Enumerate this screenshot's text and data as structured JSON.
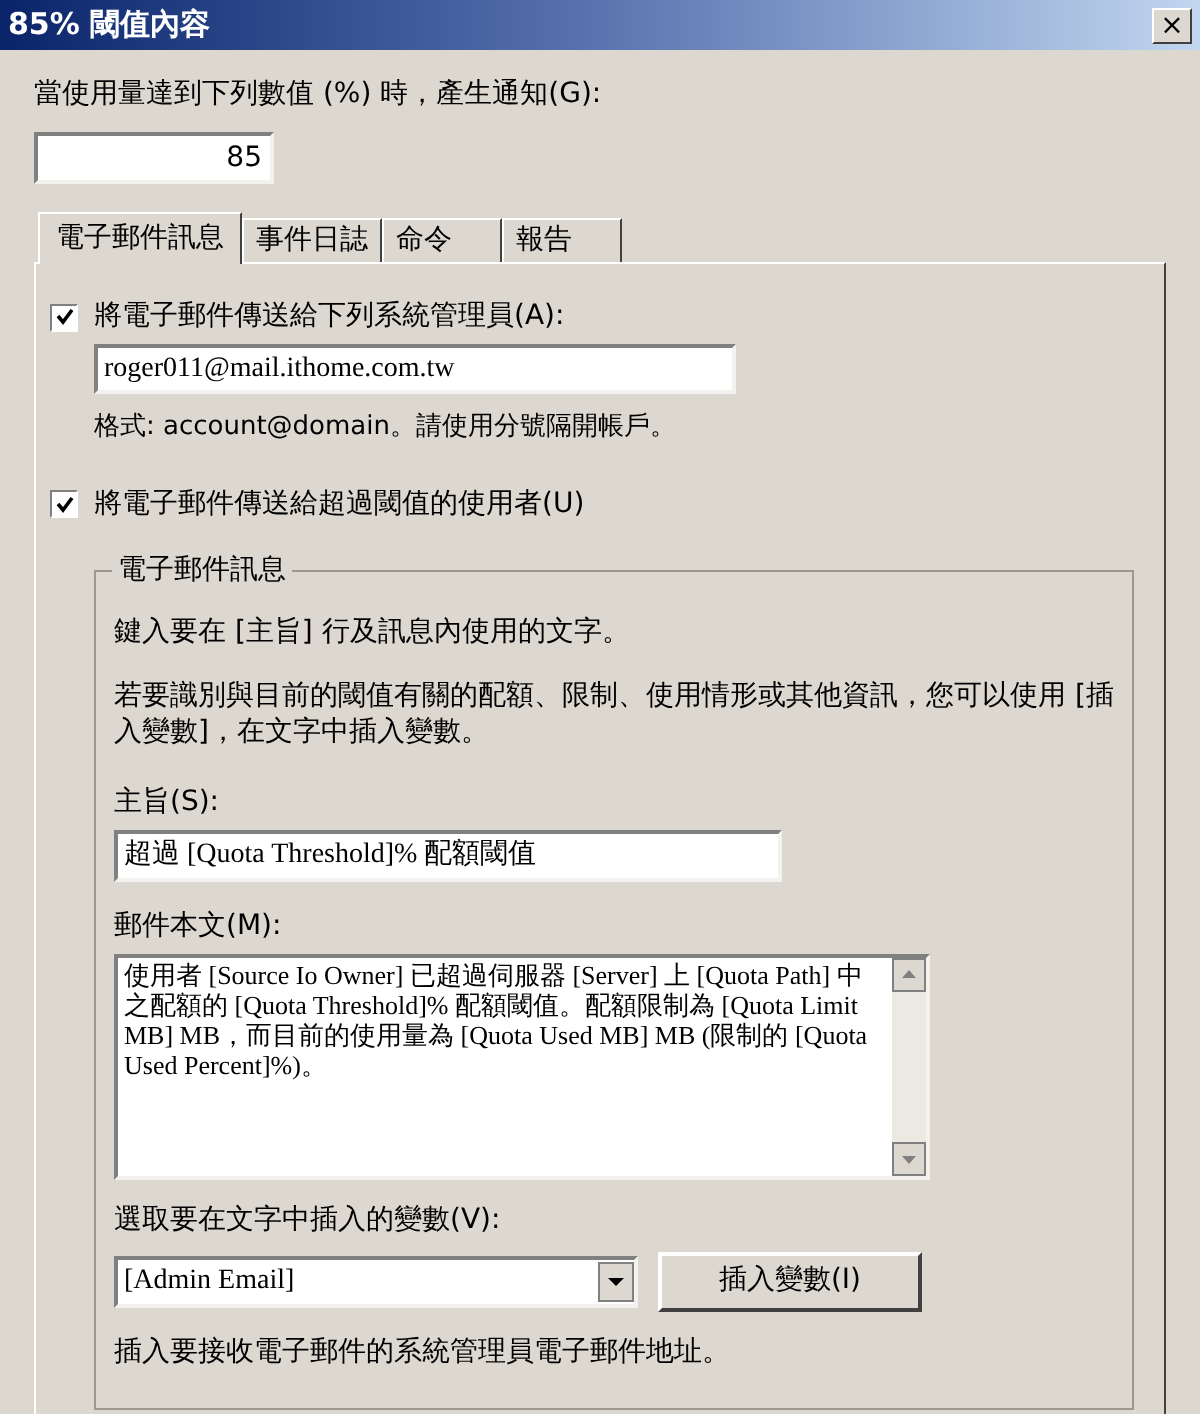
{
  "window": {
    "title": "85% 閾值內容",
    "close": "×"
  },
  "threshold": {
    "label": "當使用量達到下列數值 (%) 時，產生通知(G):",
    "value": "85"
  },
  "tabs": [
    {
      "label": "電子郵件訊息",
      "selected": true
    },
    {
      "label": "事件日誌",
      "selected": false
    },
    {
      "label": "命令",
      "selected": false
    },
    {
      "label": "報告",
      "selected": false
    }
  ],
  "send_to_admins": {
    "label": "將電子郵件傳送給下列系統管理員(A):",
    "checked": true,
    "value": "roger011@mail.ithome.com.tw",
    "hint": "格式: account@domain。請使用分號隔開帳戶。"
  },
  "send_to_user": {
    "label": "將電子郵件傳送給超過閾值的使用者(U)",
    "checked": true
  },
  "message_group": {
    "title": "電子郵件訊息",
    "intro": "鍵入要在 [主旨] 行及訊息內使用的文字。",
    "variables_note": "若要識別與目前的閾值有關的配額、限制、使用情形或其他資訊，您可以使用 [插入變數]，在文字中插入變數。",
    "subject_label": "主旨(S):",
    "subject": "超過 [Quota Threshold]% 配額閾值",
    "body_label": "郵件本文(M):",
    "body": "使用者 [Source Io Owner] 已超過伺服器 [Server] 上 [Quota Path] 中之配額的 [Quota Threshold]% 配額閾值。配額限制為 [Quota Limit MB] MB，而目前的使用量為 [Quota Used MB] MB (限制的 [Quota Used Percent]%)。",
    "variable_label": "選取要在文字中插入的變數(V):",
    "variable": "[Admin Email]",
    "insert_button": "插入變數(I)",
    "variable_description": "插入要接收電子郵件的系統管理員電子郵件地址。"
  }
}
